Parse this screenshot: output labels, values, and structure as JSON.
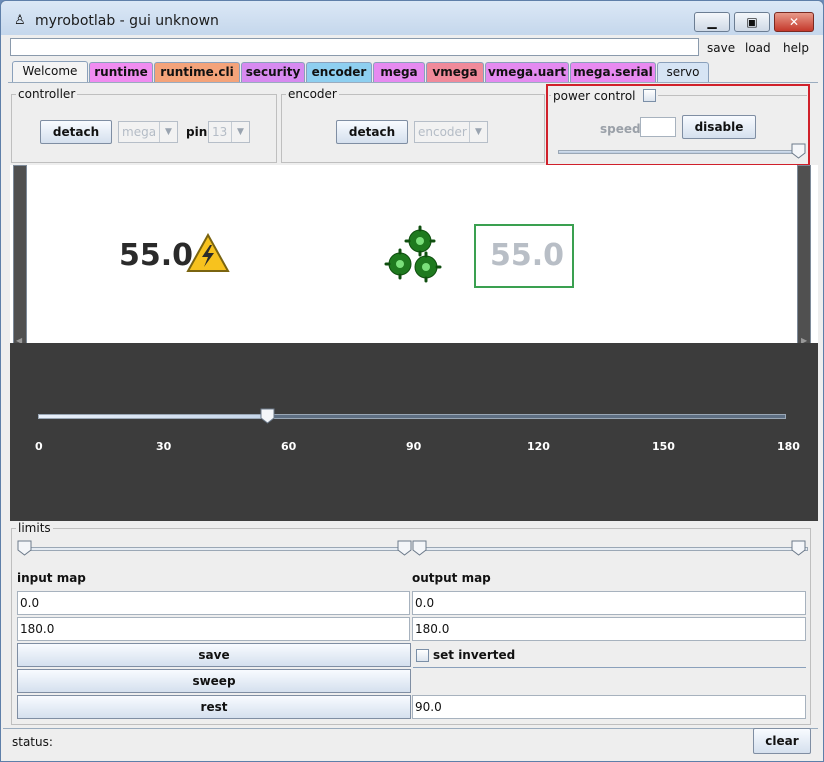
{
  "window": {
    "icon": "robot-icon",
    "title": "myrobotlab - gui unknown",
    "controls": {
      "minimize": "minimize-icon",
      "maximize": "maximize-icon",
      "close": "close-icon"
    }
  },
  "menu": {
    "save": "save",
    "load": "load",
    "help": "help"
  },
  "tabs": [
    {
      "label": "Welcome",
      "color": "#f4f4f4"
    },
    {
      "label": "runtime",
      "color": "#f08cf0"
    },
    {
      "label": "runtime.cli",
      "color": "#f4a37a"
    },
    {
      "label": "security",
      "color": "#d78af0"
    },
    {
      "label": "encoder",
      "color": "#8ecff0"
    },
    {
      "label": "mega",
      "color": "#e68af0"
    },
    {
      "label": "vmega",
      "color": "#f08a9a"
    },
    {
      "label": "vmega.uart",
      "color": "#e48af0"
    },
    {
      "label": "mega.serial",
      "color": "#e88af0"
    },
    {
      "label": "servo",
      "color": "#d6e4f4"
    }
  ],
  "controller": {
    "legend": "controller",
    "detach_label": "detach",
    "board_value": "mega",
    "pin_label": "pin",
    "pin_value": "13"
  },
  "encoder": {
    "legend": "encoder",
    "detach_label": "detach",
    "encoder_value": "encoder"
  },
  "power_control": {
    "legend": "power control",
    "speed_label": "speed",
    "speed_value": "",
    "disable_label": "disable",
    "highlight_color": "#d0202a"
  },
  "display": {
    "current_position": "55.0",
    "target_position": "55.0",
    "warning_icon": "high-voltage-warning-icon",
    "gears_icon": "gears-icon",
    "slider_value": 55,
    "ticks": [
      "0",
      "30",
      "60",
      "90",
      "120",
      "150",
      "180"
    ]
  },
  "limits": {
    "legend": "limits",
    "input_map_label": "input map",
    "output_map_label": "output map",
    "input_min": "0.0",
    "input_max": "180.0",
    "output_min": "0.0",
    "output_max": "180.0",
    "save_label": "save",
    "sweep_label": "sweep",
    "rest_label": "rest",
    "rest_value": "90.0",
    "set_inverted_label": "set inverted"
  },
  "status": {
    "label": "status:",
    "clear_label": "clear"
  }
}
